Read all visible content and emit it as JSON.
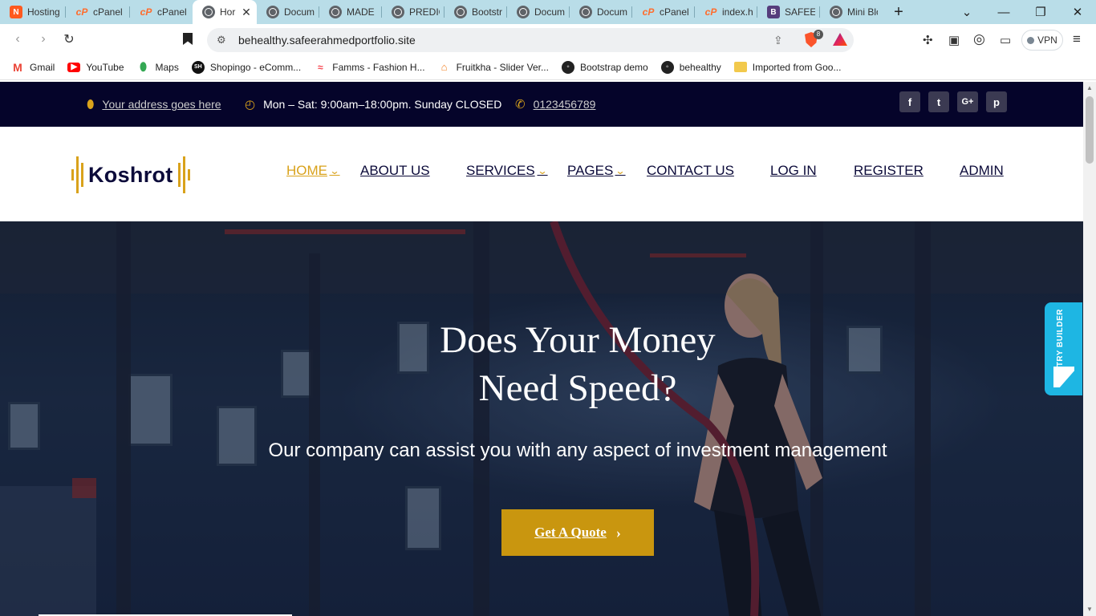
{
  "browser": {
    "tabs": [
      {
        "title": "Hosting",
        "favicon": "hostinger-icon",
        "color": "#ff5a1f"
      },
      {
        "title": "cPanel -",
        "favicon": "cpanel-icon",
        "color": "#ff6c2c"
      },
      {
        "title": "cPanel -",
        "favicon": "cpanel-icon",
        "color": "#ff6c2c"
      },
      {
        "title": "Hor",
        "favicon": "globe-icon",
        "active": true
      },
      {
        "title": "Docume",
        "favicon": "globe-icon"
      },
      {
        "title": "MADE E",
        "favicon": "globe-icon"
      },
      {
        "title": "PREDIC",
        "favicon": "globe-icon"
      },
      {
        "title": "Bootstr",
        "favicon": "globe-icon"
      },
      {
        "title": "Docume",
        "favicon": "globe-icon"
      },
      {
        "title": "Docume",
        "favicon": "globe-icon"
      },
      {
        "title": "cPanel F",
        "favicon": "cpanel-icon",
        "color": "#ff6c2c"
      },
      {
        "title": "index.ht",
        "favicon": "cpanel-icon",
        "color": "#ff6c2c"
      },
      {
        "title": "SAFEER",
        "favicon": "bootstrap-icon",
        "color": "#563d7c"
      },
      {
        "title": "Mini Blo",
        "favicon": "globe-icon"
      }
    ],
    "new_tab": "+",
    "url": "behealthy.safeerahmedportfolio.site",
    "brave_badge": "8",
    "vpn_label": "VPN",
    "bookmarks": [
      {
        "label": "Gmail",
        "icon": "gmail-icon",
        "color": "#ea4335"
      },
      {
        "label": "YouTube",
        "icon": "youtube-icon",
        "color": "#ff0000"
      },
      {
        "label": "Maps",
        "icon": "maps-icon",
        "color": "#34a853"
      },
      {
        "label": "Shopingo - eComm...",
        "icon": "shopingo-icon",
        "color": "#111111"
      },
      {
        "label": "Famms - Fashion H...",
        "icon": "famms-icon",
        "color": "#f7444e"
      },
      {
        "label": "Fruitkha - Slider Ver...",
        "icon": "fruitkha-icon",
        "color": "#f28123"
      },
      {
        "label": "Bootstrap demo",
        "icon": "globe-icon",
        "color": "#222222"
      },
      {
        "label": "behealthy",
        "icon": "globe-icon",
        "color": "#222222"
      },
      {
        "label": "Imported from Goo...",
        "icon": "folder-icon",
        "color": "#f2c94c"
      }
    ]
  },
  "topbar": {
    "address": "Your address goes here",
    "hours": "Mon – Sat: 9:00am–18:00pm. Sunday CLOSED",
    "phone": "0123456789",
    "social": [
      "f",
      "t",
      "G+",
      "p"
    ]
  },
  "header": {
    "logo_text": "Koshrot",
    "menu": [
      {
        "label": "HOME",
        "active": true,
        "dropdown": true
      },
      {
        "label": "ABOUT US"
      },
      {
        "label": "SERVICES",
        "dropdown": true
      },
      {
        "label": "PAGES",
        "dropdown": true
      },
      {
        "label": "CONTACT US"
      },
      {
        "label": "LOG IN"
      },
      {
        "label": "REGISTER"
      },
      {
        "label": "ADMIN"
      }
    ]
  },
  "hero": {
    "title_line1": "Does Your Money",
    "title_line2": "Need Speed?",
    "subtitle": "Our company can assist you with any aspect of investment management",
    "cta_label": "Get A Quote",
    "cta_arrow": "›"
  },
  "try_builder": {
    "label": "TRY BUILDER"
  },
  "colors": {
    "accent": "#d9a21b",
    "topbar_bg": "#05042a",
    "brand_text": "#0c0b3a",
    "cta_bg": "#c9960f",
    "builder_tab": "#1eb6e3"
  }
}
